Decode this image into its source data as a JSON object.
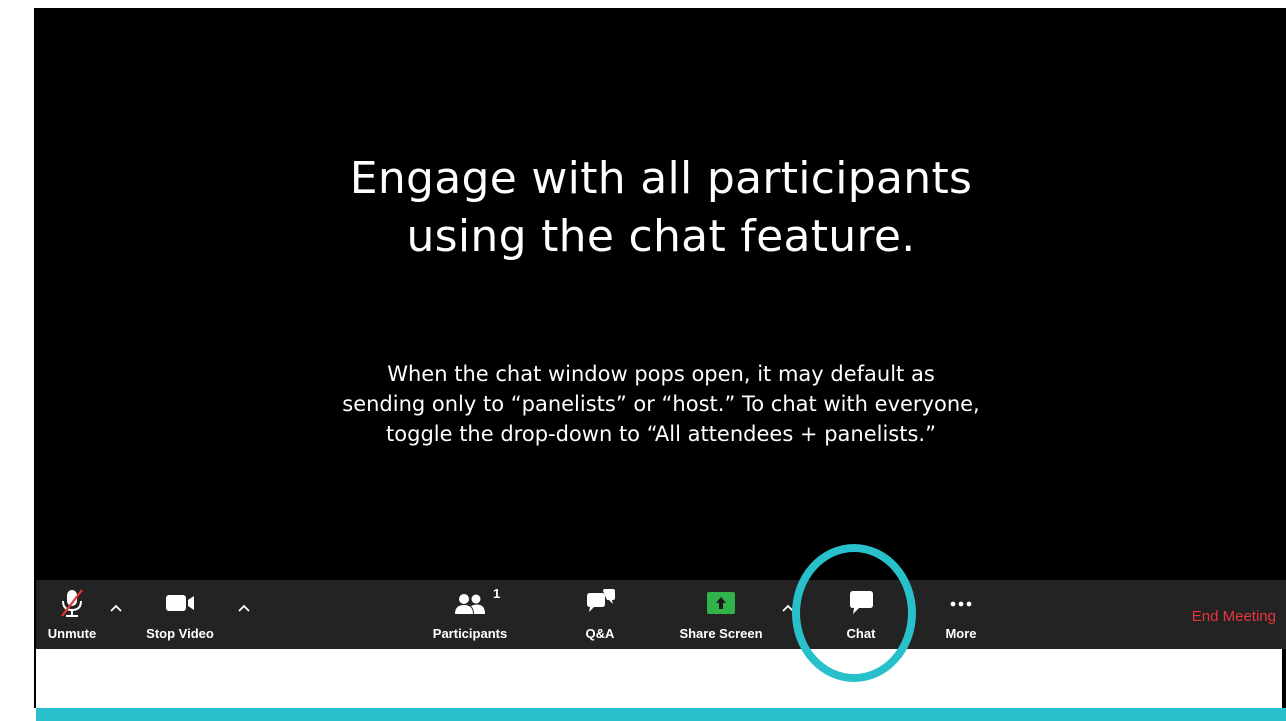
{
  "slide": {
    "headline_line1": "Engage with all participants",
    "headline_line2": "using the chat feature.",
    "body_line1": "When the chat window pops open, it may default as",
    "body_line2": "sending only to “panelists” or “host.” To chat with everyone,",
    "body_line3": "toggle the drop-down to “All attendees + panelists.”"
  },
  "toolbar": {
    "unmute_label": "Unmute",
    "stop_video_label": "Stop Video",
    "participants_label": "Participants",
    "participants_count": "1",
    "qa_label": "Q&A",
    "share_screen_label": "Share Screen",
    "chat_label": "Chat",
    "more_label": "More",
    "end_meeting_label": "End Meeting"
  },
  "icons": {
    "unmute": "mic-muted-icon",
    "stop_video": "video-camera-icon",
    "participants": "participants-icon",
    "qa": "qa-bubbles-icon",
    "share_screen": "share-screen-icon",
    "chat": "chat-bubble-icon",
    "more": "more-dots-icon",
    "caret": "chevron-up-icon"
  },
  "colors": {
    "toolbar_bg": "#232323",
    "share_green": "#2fb34a",
    "end_meeting_red": "#e8343a",
    "highlight_teal": "#28c0cb",
    "mute_slash_red": "#e8343a"
  }
}
